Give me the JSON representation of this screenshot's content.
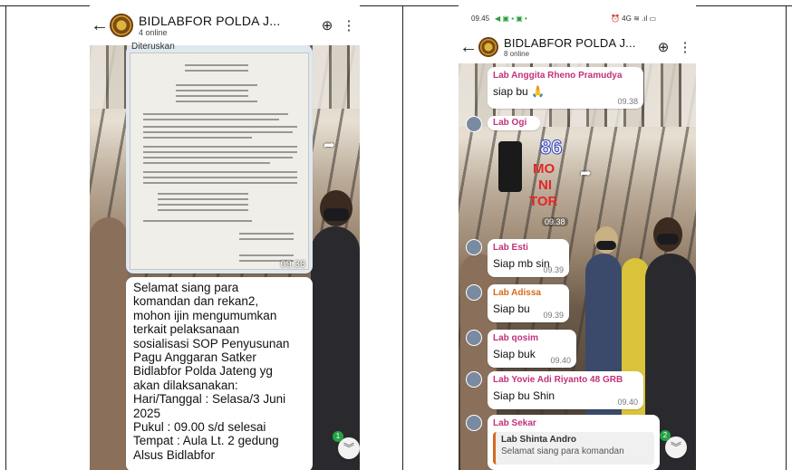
{
  "left_chat": {
    "title": "BIDLABFOR POLDA J...",
    "subtitle": "4 online",
    "top_fragment": "Diteruskan",
    "image_time": "09.36",
    "message_lines": [
      "Selamat siang para",
      "komandan dan rekan2,",
      "mohon ijin mengumumkan",
      "terkait pelaksanaan",
      "sosialisasi SOP Penyusunan",
      "Pagu Anggaran Satker",
      "Bidlabfor Polda Jateng yg",
      "akan dilaksanakan:",
      "Hari/Tanggal : Selasa/3 Juni",
      "2025",
      "Pukul : 09.00 s/d selesai",
      "Tempat : Aula Lt. 2 gedung",
      "Alsus Bidlabfor"
    ],
    "unread_badge": "1"
  },
  "right_chat": {
    "status_time": "09.45",
    "status_icons": "◀ ▣ ▪ ▣ •",
    "status_right": "⏰ 4G ≋ .ıl ▭",
    "title": "BIDLABFOR POLDA J...",
    "subtitle": "8 online",
    "messages": [
      {
        "sender": "Lab Anggita Rheno Pramudya",
        "text": "siap bu 🙏",
        "time": "09.38",
        "color": "#c2327a"
      },
      {
        "sender": "Lab Ogi",
        "text": "",
        "time": "09.38",
        "color": "#c2327a"
      },
      {
        "sender": "Lab Esti",
        "text": "Siap mb sin",
        "time": "09.39",
        "color": "#c2327a"
      },
      {
        "sender": "Lab Adissa",
        "text": "Siap bu",
        "time": "09.39",
        "color": "#d46a1f"
      },
      {
        "sender": "Lab qosim",
        "text": "Siap buk",
        "time": "09.40",
        "color": "#c2327a"
      },
      {
        "sender": "Lab Yovie Adi Riyanto 48 GRB",
        "text": "Siap bu Shin",
        "time": "09.40",
        "color": "#c2327a"
      },
      {
        "sender": "Lab Sekar",
        "text": "",
        "time": "",
        "color": "#c2327a"
      }
    ],
    "sticker": {
      "number": "86",
      "word1": "MO",
      "word2": "NI",
      "word3": "TOR"
    },
    "quote": {
      "sender": "Lab Shinta Andro",
      "text": "Selamat siang para komandan"
    },
    "unread_badge": "2"
  }
}
